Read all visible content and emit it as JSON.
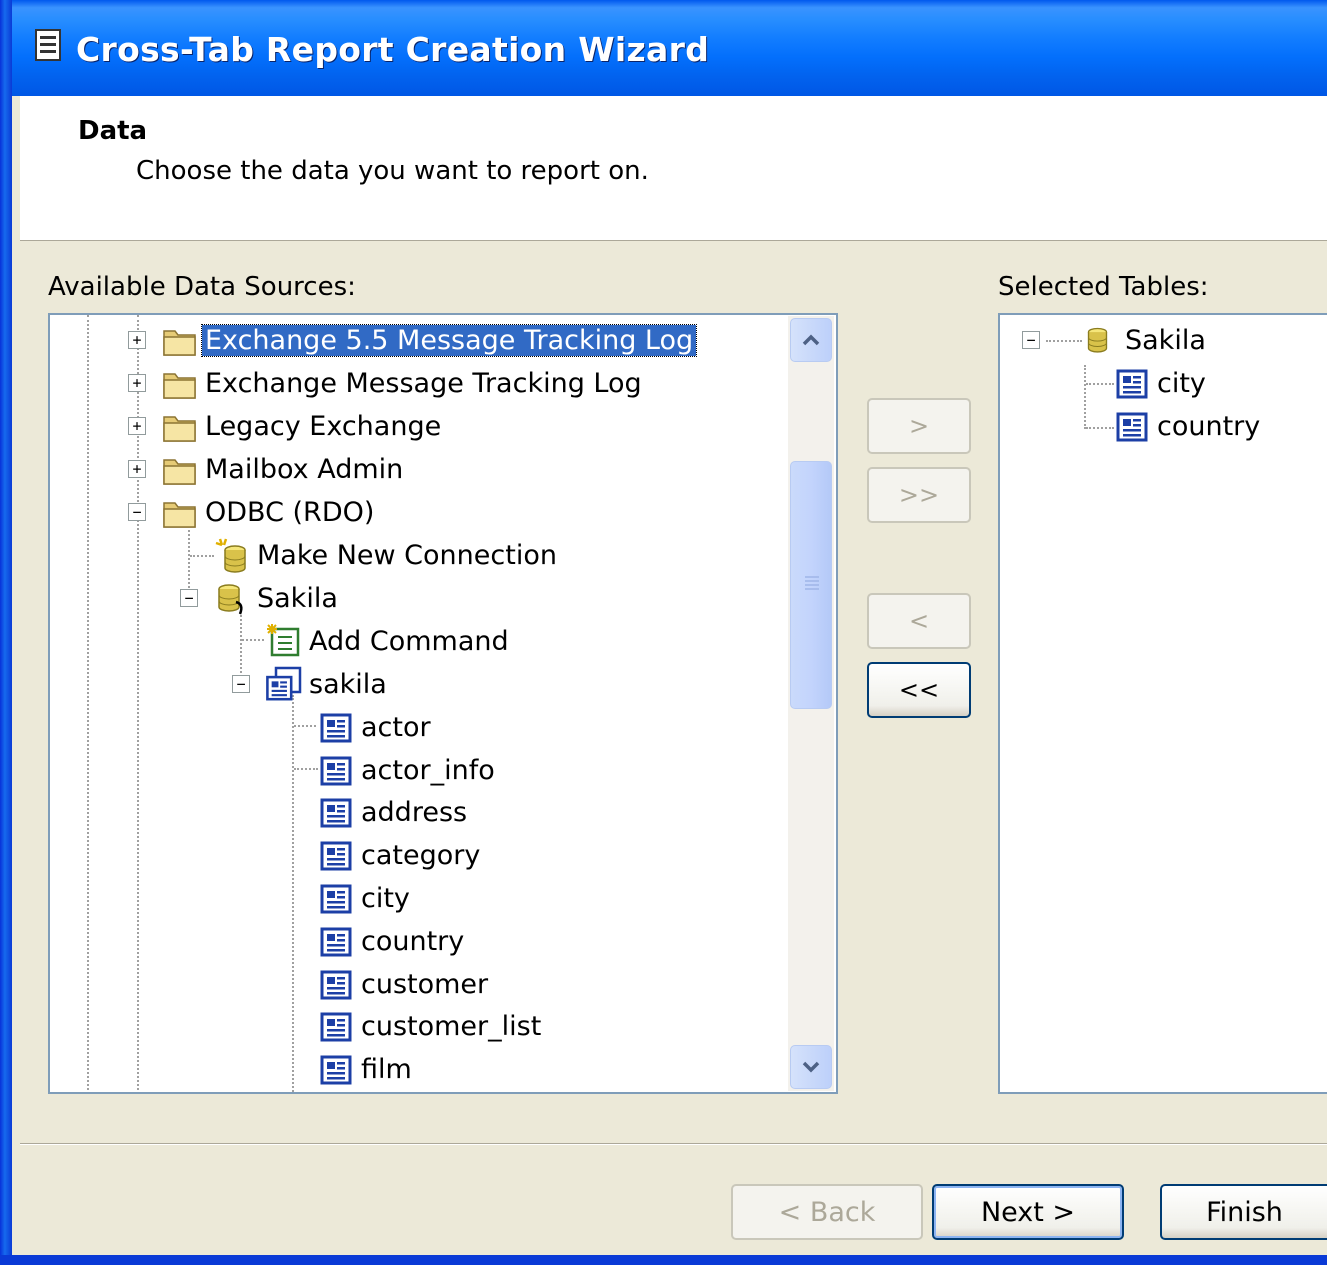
{
  "window": {
    "title": "Cross-Tab Report Creation Wizard"
  },
  "header": {
    "title": "Data",
    "subtitle": "Choose the data you want to report on."
  },
  "available": {
    "label": "Available Data Sources:",
    "items": [
      {
        "label": "Exchange 5.5 Message Tracking Log",
        "icon": "folder-icon",
        "expander": "+",
        "selected": true
      },
      {
        "label": "Exchange Message Tracking Log",
        "icon": "folder-icon",
        "expander": "+"
      },
      {
        "label": "Legacy Exchange",
        "icon": "folder-icon",
        "expander": "+"
      },
      {
        "label": "Mailbox Admin",
        "icon": "folder-icon",
        "expander": "+"
      },
      {
        "label": "ODBC (RDO)",
        "icon": "folder-icon",
        "expander": "−"
      },
      {
        "label": "Make New Connection",
        "icon": "new-connection-icon"
      },
      {
        "label": "Sakila",
        "icon": "database-icon",
        "expander": "−"
      },
      {
        "label": "Add Command",
        "icon": "add-command-icon"
      },
      {
        "label": "sakila",
        "icon": "schema-icon",
        "expander": "−"
      },
      {
        "label": "actor",
        "icon": "table-icon"
      },
      {
        "label": "actor_info",
        "icon": "table-icon"
      },
      {
        "label": "address",
        "icon": "table-icon"
      },
      {
        "label": "category",
        "icon": "table-icon"
      },
      {
        "label": "city",
        "icon": "table-icon"
      },
      {
        "label": "country",
        "icon": "table-icon"
      },
      {
        "label": "customer",
        "icon": "table-icon"
      },
      {
        "label": "customer_list",
        "icon": "table-icon"
      },
      {
        "label": "film",
        "icon": "table-icon"
      }
    ]
  },
  "selected": {
    "label": "Selected Tables:",
    "root": {
      "label": "Sakila",
      "icon": "database-icon",
      "expander": "−"
    },
    "items": [
      {
        "label": "city",
        "icon": "table-icon"
      },
      {
        "label": "country",
        "icon": "table-icon"
      }
    ]
  },
  "move_buttons": {
    "add": ">",
    "add_all": ">>",
    "remove": "<",
    "remove_all": "<<"
  },
  "nav": {
    "back": "< Back",
    "next": "Next >",
    "finish": "Finish"
  },
  "colors": {
    "title_bar": "#0058EE",
    "selection": "#316AC5",
    "dialog_bg": "#ECE9D8",
    "border": "#7F9DB9"
  }
}
